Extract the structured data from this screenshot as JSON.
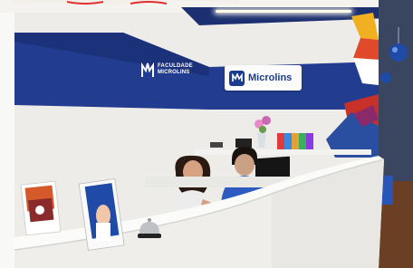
{
  "scene": {
    "left_logo_lines": [
      "FACULDADE",
      "MICROLINS"
    ],
    "right_sign_text": "Microlins",
    "colors": {
      "brand_blue": "#1f3a8a",
      "band_blue": "#223d8f",
      "wall": "#eeece8",
      "desk": "#f3f3f1",
      "floor": "#6b3f24",
      "shirt_blue": "#2d5bc0"
    },
    "icons": [
      "microlins-m-logo-icon",
      "hanging-globe-icon",
      "service-bell-icon"
    ]
  }
}
